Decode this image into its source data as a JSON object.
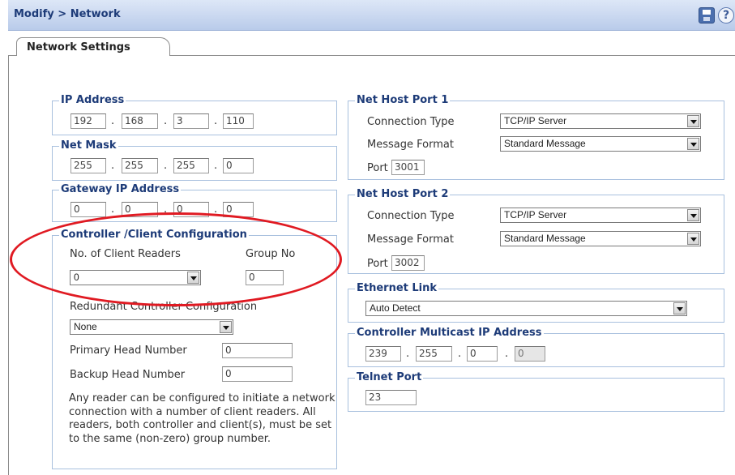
{
  "header": {
    "breadcrumb": "Modify > Network",
    "save_icon": "save-icon",
    "help_icon": "help-icon",
    "help_glyph": "?"
  },
  "tab": {
    "label": "Network Settings"
  },
  "ip_address": {
    "legend": "IP Address",
    "octets": [
      "192",
      "168",
      "3",
      "110"
    ]
  },
  "net_mask": {
    "legend": "Net Mask",
    "octets": [
      "255",
      "255",
      "255",
      "0"
    ]
  },
  "gateway": {
    "legend": "Gateway IP Address",
    "octets": [
      "0",
      "0",
      "0",
      "0"
    ]
  },
  "controller": {
    "legend": "Controller /Client Configuration",
    "client_readers_label": "No. of Client Readers",
    "client_readers_value": "0",
    "group_no_label": "Group No",
    "group_no_value": "0",
    "redundant_label": "Redundant Controller Configuration",
    "redundant_value": "None",
    "primary_label": "Primary Head Number",
    "primary_value": "0",
    "backup_label": "Backup Head Number",
    "backup_value": "0",
    "note": "Any reader can be configured to initiate a network connection with a number of client readers. All readers, both controller and client(s), must be set to the same (non-zero) group number."
  },
  "host_port_1": {
    "legend": "Net Host Port 1",
    "connection_type_label": "Connection Type",
    "connection_type_value": "TCP/IP Server",
    "message_format_label": "Message Format",
    "message_format_value": "Standard Message",
    "port_label": "Port",
    "port_value": "3001"
  },
  "host_port_2": {
    "legend": "Net Host Port 2",
    "connection_type_label": "Connection Type",
    "connection_type_value": "TCP/IP Server",
    "message_format_label": "Message Format",
    "message_format_value": "Standard Message",
    "port_label": "Port",
    "port_value": "3002"
  },
  "ethernet_link": {
    "legend": "Ethernet Link",
    "value": "Auto Detect"
  },
  "multicast": {
    "legend": "Controller Multicast IP Address",
    "octets": [
      "239",
      "255",
      "0",
      "0"
    ]
  },
  "telnet": {
    "legend": "Telnet Port",
    "value": "23"
  },
  "annotation": {
    "color": "#e01a22"
  }
}
